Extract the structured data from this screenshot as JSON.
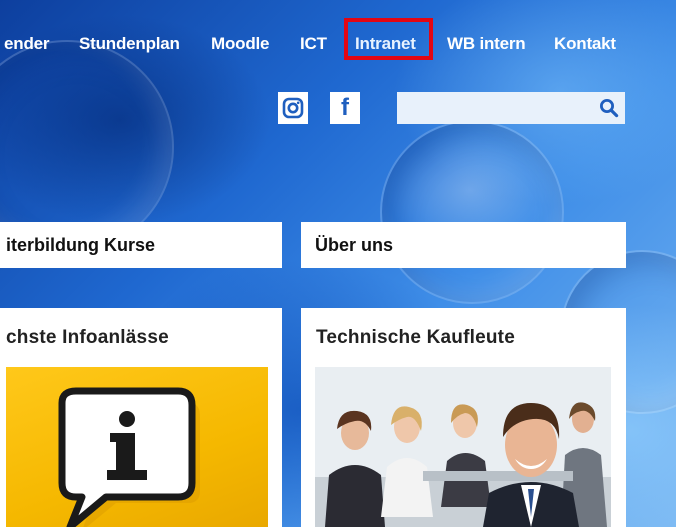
{
  "nav": {
    "items": [
      {
        "label": "ender",
        "active": false
      },
      {
        "label": "Stundenplan",
        "active": false
      },
      {
        "label": "Moodle",
        "active": false
      },
      {
        "label": "ICT",
        "active": false
      },
      {
        "label": "Intranet",
        "active": true
      },
      {
        "label": "WB intern",
        "active": false
      },
      {
        "label": "Kontakt",
        "active": false
      }
    ],
    "highlight_color": "#e30613"
  },
  "social": {
    "instagram_icon": "instagram-icon",
    "facebook_icon": "facebook-icon",
    "facebook_glyph": "f"
  },
  "search": {
    "value": "",
    "placeholder": "",
    "icon": "search-icon"
  },
  "tiles": {
    "weiterbildung_label": "iterbildung Kurse",
    "ueber_uns_label": "Über uns"
  },
  "cards": {
    "infoanlaesse_title": "chste Infoanlässe",
    "infoanlaesse_image": "info-speech-bubble-image",
    "kaufleute_title": "Technische Kaufleute",
    "kaufleute_image": "business-team-photo"
  },
  "colors": {
    "background_blue": "#1f68d0",
    "card_white": "#ffffff",
    "search_icon_blue": "#1f5fbf",
    "info_yellow": "#f5b800"
  }
}
